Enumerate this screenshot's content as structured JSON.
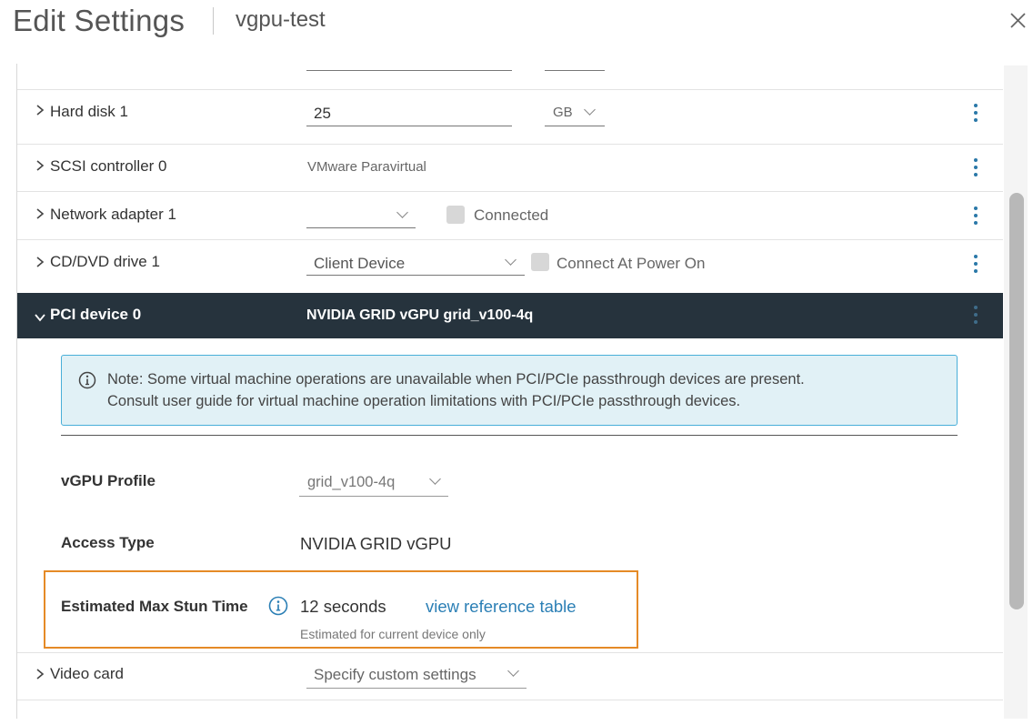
{
  "header": {
    "title": "Edit Settings",
    "vm_name": "vgpu-test"
  },
  "rows": {
    "hard_disk": {
      "label": "Hard disk 1",
      "size": "25",
      "unit": "GB"
    },
    "scsi": {
      "label": "SCSI controller 0",
      "value": "VMware Paravirtual"
    },
    "network": {
      "label": "Network adapter 1",
      "network_value": "",
      "connected_label": "Connected"
    },
    "cddvd": {
      "label": "CD/DVD drive 1",
      "device": "Client Device",
      "power_label": "Connect At Power On"
    },
    "pci": {
      "label": "PCI device 0",
      "value": "NVIDIA GRID vGPU grid_v100-4q"
    },
    "video": {
      "label": "Video card",
      "value": "Specify custom settings"
    }
  },
  "note": {
    "line1": "Note: Some virtual machine operations are unavailable when PCI/PCIe passthrough devices are present.",
    "line2": "Consult user guide for virtual machine operation limitations with PCI/PCIe passthrough devices."
  },
  "pci_details": {
    "vgpu_profile_label": "vGPU Profile",
    "vgpu_profile_value": "grid_v100-4q",
    "access_type_label": "Access Type",
    "access_type_value": "NVIDIA GRID vGPU",
    "stun_label": "Estimated Max Stun Time",
    "stun_value": "12 seconds",
    "stun_link": "view reference table",
    "stun_hint": "Estimated for current device only"
  },
  "colors": {
    "accent": "#2b7fb5",
    "pci_header_bg": "#26333d",
    "highlight": "#e58a26",
    "note_bg": "#e1f1f6",
    "note_border": "#49afd9"
  },
  "icons": [
    "close-icon",
    "chevron-right-icon",
    "chevron-down-icon",
    "kebab-icon",
    "caret-down-icon",
    "info-icon"
  ]
}
